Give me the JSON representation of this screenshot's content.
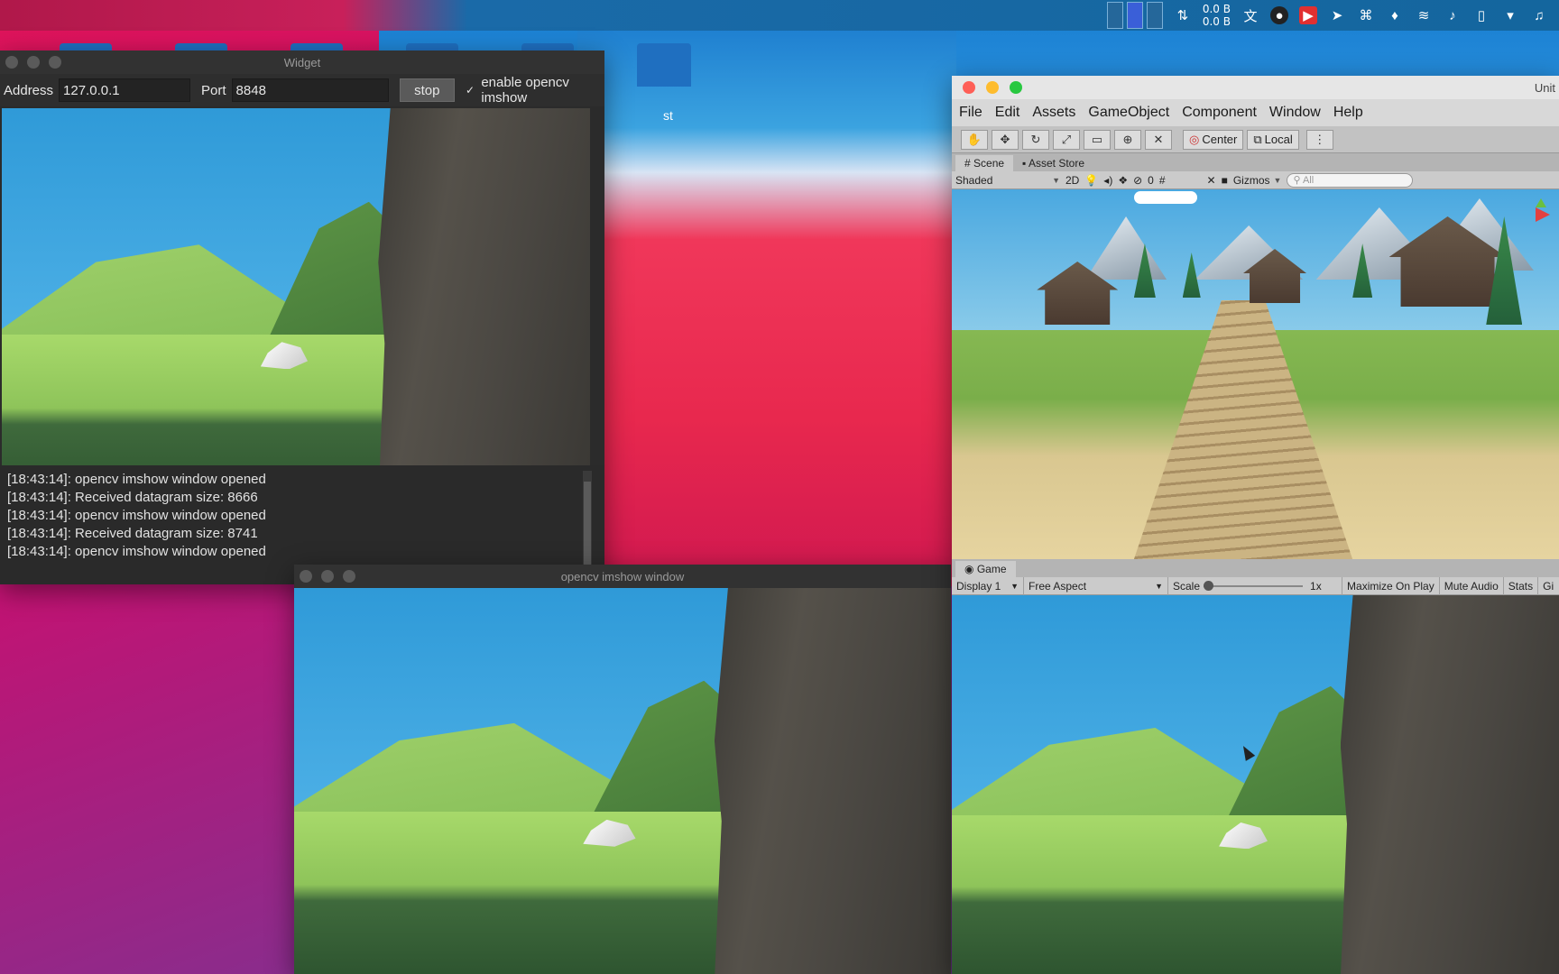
{
  "topbar": {
    "net_up": "0.0 B",
    "net_down": "0.0 B",
    "tray_icons": [
      "arrows-updown-icon",
      "translate-icon",
      "obs-icon",
      "screenrecord-icon",
      "telegram-icon",
      "keyboard-icon",
      "lightbulb-icon",
      "wifi-icon",
      "volume-icon",
      "clipboard-icon",
      "chevron-down-icon",
      "bell-icon"
    ]
  },
  "desktop": {
    "partial_label": "st"
  },
  "widget": {
    "title": "Widget",
    "address_label": "Address",
    "address_value": "127.0.0.1",
    "port_label": "Port",
    "port_value": "8848",
    "stop_label": "stop",
    "checkbox_mark": "✓",
    "checkbox_label": "enable opencv imshow",
    "log": [
      "[18:43:14]: opencv imshow window opened",
      "[18:43:14]: Received datagram size: 8666",
      "[18:43:14]: opencv imshow window opened",
      "[18:43:14]: Received datagram size: 8741",
      "[18:43:14]: opencv imshow window opened"
    ]
  },
  "cv_window": {
    "title": "opencv imshow window"
  },
  "unity": {
    "title": "Unit",
    "menu": [
      "File",
      "Edit",
      "Assets",
      "GameObject",
      "Component",
      "Window",
      "Help"
    ],
    "pivot_center": "Center",
    "pivot_local": "Local",
    "tabs": {
      "scene": "Scene",
      "asset_store": "Asset Store"
    },
    "scene_opts": {
      "shaded": "Shaded",
      "mode2d": "2D",
      "hidden_count": "0",
      "gizmos": "Gizmos",
      "search": "All"
    },
    "game_tab": "Game",
    "game_opts": {
      "display": "Display 1",
      "aspect": "Free Aspect",
      "scale_label": "Scale",
      "scale_value": "1x",
      "maximize": "Maximize On Play",
      "mute": "Mute Audio",
      "stats": "Stats",
      "gizmos": "Gi"
    }
  }
}
